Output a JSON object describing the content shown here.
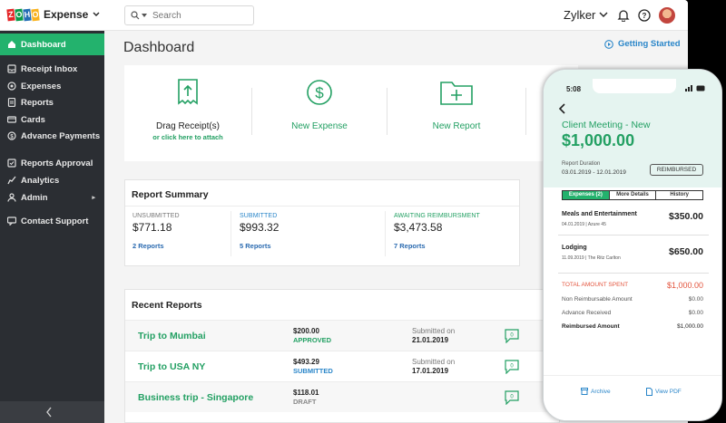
{
  "app": {
    "brand_letters": [
      "Z",
      "O",
      "H",
      "O"
    ],
    "brand_colors": [
      "#e42527",
      "#089949",
      "#226db4",
      "#f9b21d"
    ],
    "name": "Expense"
  },
  "search": {
    "placeholder": "Search"
  },
  "header": {
    "org": "Zylker"
  },
  "sidebar": {
    "items": [
      {
        "label": "Dashboard",
        "icon": "home-icon",
        "active": true
      },
      {
        "label": "Receipt Inbox",
        "icon": "inbox-icon"
      },
      {
        "label": "Expenses",
        "icon": "coin-icon"
      },
      {
        "label": "Reports",
        "icon": "report-icon"
      },
      {
        "label": "Cards",
        "icon": "card-icon"
      },
      {
        "label": "Advance Payments",
        "icon": "dollar-circle-icon"
      },
      {
        "label": "Reports Approval",
        "icon": "approval-icon"
      },
      {
        "label": "Analytics",
        "icon": "chart-icon"
      },
      {
        "label": "Admin",
        "icon": "user-icon",
        "arrow": "▸"
      },
      {
        "label": "Contact Support",
        "icon": "chat-icon"
      }
    ]
  },
  "main": {
    "title": "Dashboard",
    "getting_started": "Getting Started",
    "quick_actions": [
      {
        "label": "Drag Receipt(s)",
        "sub": "or click here to attach"
      },
      {
        "label": "New Expense"
      },
      {
        "label": "New Report"
      }
    ],
    "summary": {
      "title": "Report Summary",
      "cols": [
        {
          "label": "UNSUBMITTED",
          "value": "$771.18",
          "link": "2 Reports"
        },
        {
          "label": "SUBMITTED",
          "value": "$993.32",
          "link": "5 Reports"
        },
        {
          "label": "AWAITING REIMBURSMENT",
          "value": "$3,473.58",
          "link": "7 Reports"
        }
      ]
    },
    "recent": {
      "title": "Recent Reports",
      "rows": [
        {
          "name": "Trip to Mumbai",
          "amount": "$200.00",
          "status": "APPROVED",
          "status_color": "#23a063",
          "sub_label": "Submitted on",
          "date": "21.01.2019",
          "comments": "0"
        },
        {
          "name": "Trip to USA NY",
          "amount": "$493.29",
          "status": "SUBMITTED",
          "status_color": "#2a86c9",
          "sub_label": "Submitted on",
          "date": "17.01.2019",
          "comments": "0"
        },
        {
          "name": "Business trip - Singapore",
          "amount": "$118.01",
          "status": "DRAFT",
          "status_color": "#888888",
          "sub_label": "",
          "date": "",
          "comments": "0"
        }
      ]
    }
  },
  "phone": {
    "time": "5:08",
    "report_title": "Client Meeting - New",
    "report_total": "$1,000.00",
    "duration_label": "Report Duration",
    "duration_value": "03.01.2019 - 12.01.2019",
    "badge": "REIMBURSED",
    "tabs": [
      "Expenses (2)",
      "More Details",
      "History"
    ],
    "expenses": [
      {
        "name": "Meals and Entertainment",
        "date": "04.01.2019",
        "merchant": "Azure 45",
        "amount": "$350.00"
      },
      {
        "name": "Lodging",
        "date": "11.09.2019",
        "merchant": "The Ritz Carlton",
        "amount": "$650.00"
      }
    ],
    "totals": [
      {
        "label": "TOTAL AMOUNT SPENT",
        "value": "$1,000.00"
      },
      {
        "label": "Non Reimbursable Amount",
        "value": "$0.00"
      },
      {
        "label": "Advance Received",
        "value": "$0.00"
      },
      {
        "label": "Reimbursed Amount",
        "value": "$1,000.00"
      }
    ],
    "footer": {
      "archive": "Archive",
      "view_pdf": "View PDF"
    }
  }
}
